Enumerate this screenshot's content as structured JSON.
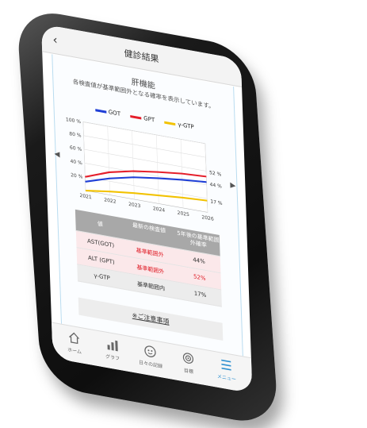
{
  "header": {
    "back_label": "‹",
    "title": "健診結果"
  },
  "section": {
    "title": "肝機能",
    "description": "各検査値が基準範囲外となる確率を表示しています。"
  },
  "legend": [
    {
      "name": "GOT",
      "color": "#1f3fd6"
    },
    {
      "name": "GPT",
      "color": "#e51e2a"
    },
    {
      "name": "γ-GTP",
      "color": "#f2c200"
    }
  ],
  "chart_data": {
    "type": "line",
    "x": [
      2021,
      2022,
      2023,
      2024,
      2025,
      2026
    ],
    "ylim": [
      0,
      100
    ],
    "ytick_labels": [
      "20 %",
      "40 %",
      "60 %",
      "80 %",
      "100 %"
    ],
    "series": [
      {
        "name": "GOT",
        "values": [
          13,
          24,
          32,
          37,
          41,
          44
        ]
      },
      {
        "name": "GPT",
        "values": [
          20,
          33,
          41,
          46,
          50,
          52
        ]
      },
      {
        "name": "γ-GTP",
        "values": [
          0,
          5,
          9,
          12,
          15,
          17
        ]
      }
    ],
    "end_labels": [
      "52 %",
      "44 %",
      "17 %"
    ]
  },
  "table": {
    "headers": [
      "値",
      "最新の検査値",
      "5年後の基準範囲外確率"
    ],
    "rows": [
      {
        "name": "AST(GOT)",
        "value": "基準範囲外",
        "prob": "44%",
        "red_value": true,
        "red_prob": false
      },
      {
        "name": "ALT (GPT)",
        "value": "基準範囲外",
        "prob": "52%",
        "red_value": true,
        "red_prob": true
      },
      {
        "name": "γ-GTP",
        "value": "基準範囲内",
        "prob": "17%",
        "red_value": false,
        "red_prob": false
      }
    ]
  },
  "notice": "※ご注意事項",
  "tabs": [
    {
      "label": "ホーム",
      "icon": "home-icon"
    },
    {
      "label": "グラフ",
      "icon": "bar-chart-icon"
    },
    {
      "label": "日々の記録",
      "icon": "face-icon"
    },
    {
      "label": "目標",
      "icon": "target-icon"
    },
    {
      "label": "メニュー",
      "icon": "menu-icon",
      "active": true
    }
  ]
}
